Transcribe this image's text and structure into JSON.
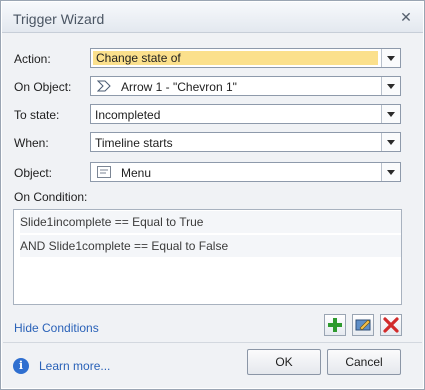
{
  "window": {
    "title": "Trigger Wizard"
  },
  "form": {
    "action": {
      "label": "Action:",
      "value": "Change state of"
    },
    "on_object": {
      "label": "On Object:",
      "value": "Arrow 1 - \"Chevron 1\"",
      "icon": "chevron-shape-icon"
    },
    "to_state": {
      "label": "To state:",
      "value": "Incompleted"
    },
    "when": {
      "label": "When:",
      "value": "Timeline starts"
    },
    "object": {
      "label": "Object:",
      "value": "Menu",
      "icon": "menu-object-icon"
    }
  },
  "conditions": {
    "label": "On Condition:",
    "items": [
      "Slide1incomplete == Equal to True",
      "AND Slide1complete == Equal to False"
    ],
    "hide_link": "Hide Conditions"
  },
  "footer": {
    "learn_more": "Learn more...",
    "ok": "OK",
    "cancel": "Cancel"
  },
  "colors": {
    "highlight": "#fbe08c",
    "link": "#2a62b8",
    "add": "#2e9a2e",
    "delete": "#d22b2b"
  }
}
